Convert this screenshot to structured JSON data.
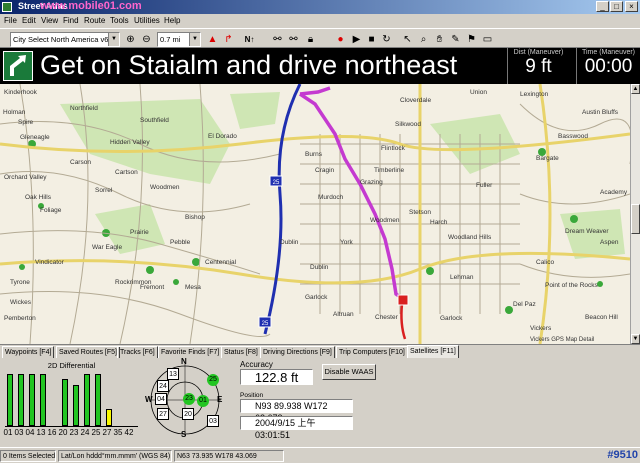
{
  "window": {
    "title": "Street Atlas",
    "watermark": "www.mobile01.com"
  },
  "menu": [
    "File",
    "Edit",
    "View",
    "Find",
    "Route",
    "Tools",
    "Utilities",
    "Help"
  ],
  "toolbar": {
    "map_selector": "City Select North America v6",
    "zoom_value": "0.7 mi"
  },
  "banner": {
    "instruction": "Get on Staialm and drive northeast",
    "dist_label": "Dist (Maneuver)",
    "dist_value": "9 ft",
    "time_label": "Time (Maneuver)",
    "time_value": "00:00"
  },
  "map": {
    "labels": [
      "Kinderhook",
      "Holman",
      "Spire",
      "Gleneagle",
      "Orchard Valley",
      "Northfield",
      "Southfield",
      "Hidden Valley",
      "El Dorado",
      "Carson",
      "Cartson",
      "Oak Hills",
      "Foliage",
      "Sorrel",
      "Woodmen",
      "Bishop",
      "Prairie",
      "War Eagle",
      "Vindicator",
      "Rockrimmon",
      "Fremont",
      "Mesa",
      "Garlock",
      "Pebble",
      "Centennial",
      "Dublin",
      "Cragin",
      "Burns",
      "Murdoch",
      "Grazing",
      "Timberline",
      "Flintlock",
      "Silkwood",
      "Cloverdale",
      "Fuller",
      "Bargate",
      "Basswood",
      "Harch",
      "Woodland Hills",
      "Stetson",
      "Dream Weaver",
      "Calico",
      "Austin Bluffs",
      "Point of the Rocks",
      "Del Paz",
      "York",
      "Altruan",
      "Chester",
      "Woodmen",
      "Vickers",
      "Dublin",
      "Union",
      "Lexington",
      "Wickes",
      "Tyrone",
      "Pemberton",
      "Garlock",
      "Academy",
      "Lehman",
      "Beacon Hill",
      "Aspen"
    ],
    "credit": "Vickers GPS Map Detail",
    "highway_labels": [
      "25",
      "25",
      "83"
    ]
  },
  "tabs": [
    "Waypoints [F4]",
    "Saved Routes [F5]",
    "Tracks [F6]",
    "Favorite Finds [F7]",
    "Status [F8]",
    "Driving Directions [F9]",
    "Trip Computers [F10]",
    "Satellites [F11]"
  ],
  "satellites": {
    "mode": "2D Differential",
    "chart_data": {
      "type": "bar",
      "categories": [
        "01",
        "03",
        "04",
        "13",
        "16",
        "20",
        "23",
        "24",
        "25",
        "27",
        "35",
        "42"
      ],
      "values": [
        0.95,
        0.95,
        0.95,
        0.95,
        0,
        0.85,
        0.75,
        0.95,
        0.95,
        0.3,
        0,
        0
      ],
      "colors": [
        "#22c522",
        "#22c522",
        "#22c522",
        "#22c522",
        "#22c522",
        "#22c522",
        "#22c522",
        "#22c522",
        "#22c522",
        "#f7f700",
        "#22c522",
        "#22c522"
      ],
      "ylim": [
        0,
        1
      ]
    },
    "compass": {
      "n": "N",
      "s": "S",
      "e": "E",
      "w": "W"
    },
    "skyplot": [
      {
        "id": "13",
        "style": "box"
      },
      {
        "id": "24",
        "style": "box"
      },
      {
        "id": "25",
        "style": "green"
      },
      {
        "id": "04",
        "style": "box"
      },
      {
        "id": "23",
        "style": "green"
      },
      {
        "id": "01",
        "style": "green"
      },
      {
        "id": "27",
        "style": "box"
      },
      {
        "id": "20",
        "style": "box"
      },
      {
        "id": "03",
        "style": "box"
      }
    ],
    "accuracy_label": "Accuracy",
    "accuracy_value": "122.8 ft",
    "waas_button": "Disable WAAS",
    "position_label": "Position",
    "position_value": "N93 89.938 W172 62.673",
    "datetime_value": "2004/9/15  上午 03:01:51"
  },
  "statusbar": {
    "items_selected": "0 Items Selected",
    "coord_format": "Lat/Lon hddd°mm.mmm' (WGS 84)",
    "coords": "N63 73.935 W178 43.069",
    "tag": "#9510"
  }
}
